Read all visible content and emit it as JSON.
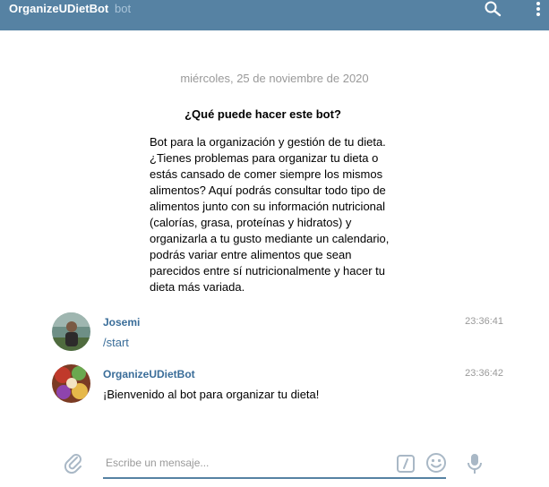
{
  "header": {
    "title": "OrganizeUDietBot",
    "subtitle": "bot",
    "background": "#5682a3",
    "search_icon": "search-icon",
    "menu_icon": "more-vertical-icon"
  },
  "date_separator": "miércoles, 25 de noviembre de 2020",
  "bot_info": {
    "heading": "¿Qué puede hacer este bot?",
    "description": "Bot para la organización y gestión de tu dieta. ¿Tienes problemas para organizar tu dieta o estás cansado de comer siempre los mismos alimentos? Aquí podrás consultar todo tipo de alimentos junto con su información nutricional (calorías, grasa, proteínas y hidratos) y organizarla a tu gusto mediante un calendario, podrás variar entre alimentos que sean parecidos entre sí nutricionalmente y hacer tu dieta más variada."
  },
  "messages": [
    {
      "author": "Josemi",
      "time": "23:36:41",
      "text": "/start"
    },
    {
      "author": "OrganizeUDietBot",
      "time": "23:36:42",
      "text": "¡Bienvenido al bot para organizar tu dieta!"
    }
  ],
  "composer": {
    "placeholder": "Escribe un mensaje...",
    "attach_icon": "paperclip-icon",
    "command_icon": "slash-command-icon",
    "emoji_icon": "smiley-icon",
    "mic_icon": "microphone-icon",
    "accent": "#5682a3"
  },
  "colors": {
    "author": "#3a6d99",
    "muted": "#999999"
  }
}
